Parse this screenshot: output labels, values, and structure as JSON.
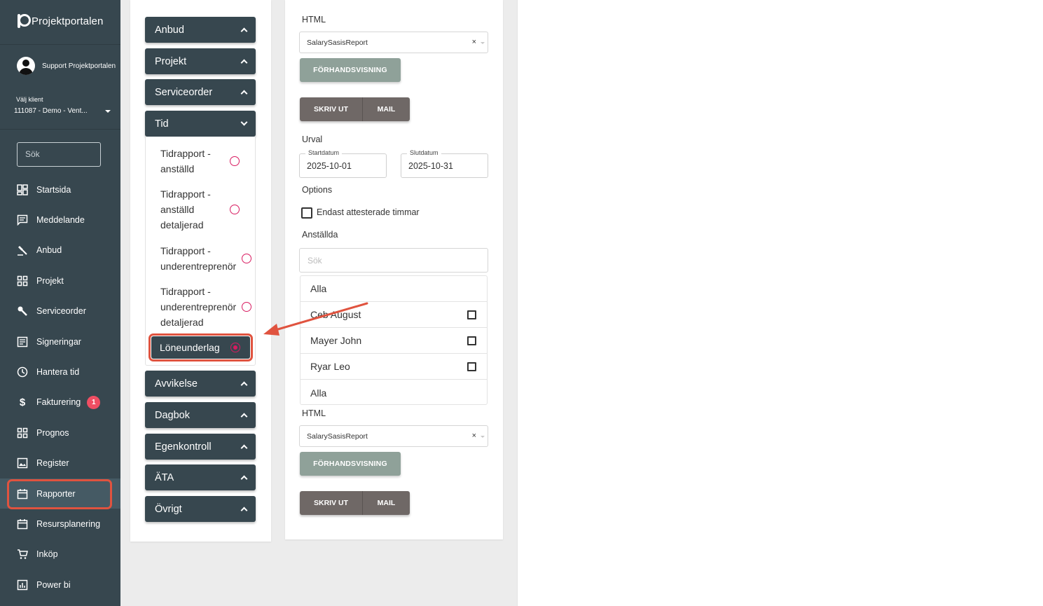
{
  "sidebar": {
    "app_name": "Projektportalen",
    "user_name": "Support Projektportalen",
    "client_label": "Välj klient",
    "client_value": "111087 - Demo - Vent...",
    "search_placeholder": "Sök",
    "items": [
      {
        "label": "Startsida",
        "icon": "dashboard-icon"
      },
      {
        "label": "Meddelande",
        "icon": "message-icon"
      },
      {
        "label": "Anbud",
        "icon": "gavel-icon"
      },
      {
        "label": "Projekt",
        "icon": "grid-icon"
      },
      {
        "label": "Serviceorder",
        "icon": "wrench-icon"
      },
      {
        "label": "Signeringar",
        "icon": "document-icon"
      },
      {
        "label": "Hantera tid",
        "icon": "clock-icon"
      },
      {
        "label": "Fakturering",
        "icon": "dollar-icon",
        "badge": "1"
      },
      {
        "label": "Prognos",
        "icon": "grid-icon"
      },
      {
        "label": "Register",
        "icon": "image-icon"
      },
      {
        "label": "Rapporter",
        "icon": "calendar-icon"
      },
      {
        "label": "Resursplanering",
        "icon": "calendar-icon"
      },
      {
        "label": "Inköp",
        "icon": "cart-icon"
      },
      {
        "label": "Power bi",
        "icon": "chart-icon"
      }
    ]
  },
  "reports": {
    "groups": {
      "anbud": "Anbud",
      "projekt": "Projekt",
      "serviceorder": "Serviceorder",
      "tid": "Tid",
      "avvikelse": "Avvikelse",
      "dagbok": "Dagbok",
      "egenkontroll": "Egenkontroll",
      "ata": "ÄTA",
      "ovrigt": "Övrigt"
    },
    "tid_items": {
      "r1_l1": "Tidrapport -",
      "r1_l2": "anställd",
      "r2_l1": "Tidrapport -",
      "r2_l2": "anställd",
      "r2_l3": "detaljerad",
      "r3_l1": "Tidrapport -",
      "r3_l2": "underentreprenör",
      "r4_l1": "Tidrapport -",
      "r4_l2": "underentreprenör",
      "r4_l3": "detaljerad",
      "selected": "Löneunderlag"
    }
  },
  "settings": {
    "format_label": "HTML",
    "format_value": "SalarySasisReport",
    "clear": "×",
    "preview_label": "FÖRHANDSVISNING",
    "print_label": "SKRIV UT",
    "mail_label": "MAIL",
    "selection_label": "Urval",
    "start_label": "Startdatum",
    "start_value": "2025-10-01",
    "end_label": "Slutdatum",
    "end_value": "2025-10-31",
    "options_label": "Options",
    "checkbox_label": "Endast attesterade timmar",
    "employees_label": "Anställda",
    "employees_search_placeholder": "Sök",
    "employees": [
      "Alla",
      "Ceb August",
      "Mayer John",
      "Ryar Leo",
      "Alla"
    ],
    "format_label_2": "HTML",
    "format_value_2": "SalarySasisReport"
  }
}
